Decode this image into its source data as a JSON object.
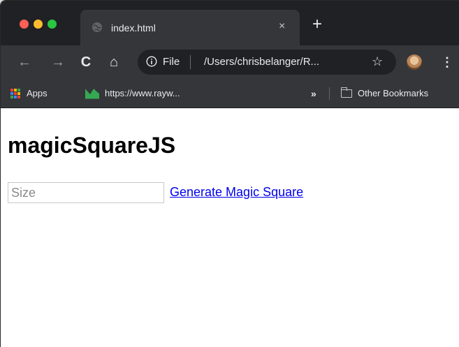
{
  "browser": {
    "tab": {
      "title": "index.html",
      "close_glyph": "×"
    },
    "new_tab_glyph": "+",
    "toolbar": {
      "back_glyph": "←",
      "forward_glyph": "→",
      "reload_glyph": "C",
      "home_glyph": "⌂",
      "scheme_label": "File",
      "url": "/Users/chrisbelanger/R...",
      "star_glyph": "☆",
      "menu_glyph": "⋮"
    },
    "bookmarks": {
      "apps_label": "Apps",
      "raywenderlich_label": "https://www.rayw...",
      "overflow_glyph": "»",
      "other_label": "Other Bookmarks"
    }
  },
  "page": {
    "title": "magicSquareJS",
    "size_input": {
      "placeholder": "Size",
      "value": ""
    },
    "generate_link": "Generate Magic Square"
  },
  "colors": {
    "tab_strip": "#202124",
    "toolbar": "#35363a",
    "link": "#0000ee",
    "traffic_red": "#fe5f57",
    "traffic_yellow": "#febc2e",
    "traffic_green": "#28c840"
  }
}
